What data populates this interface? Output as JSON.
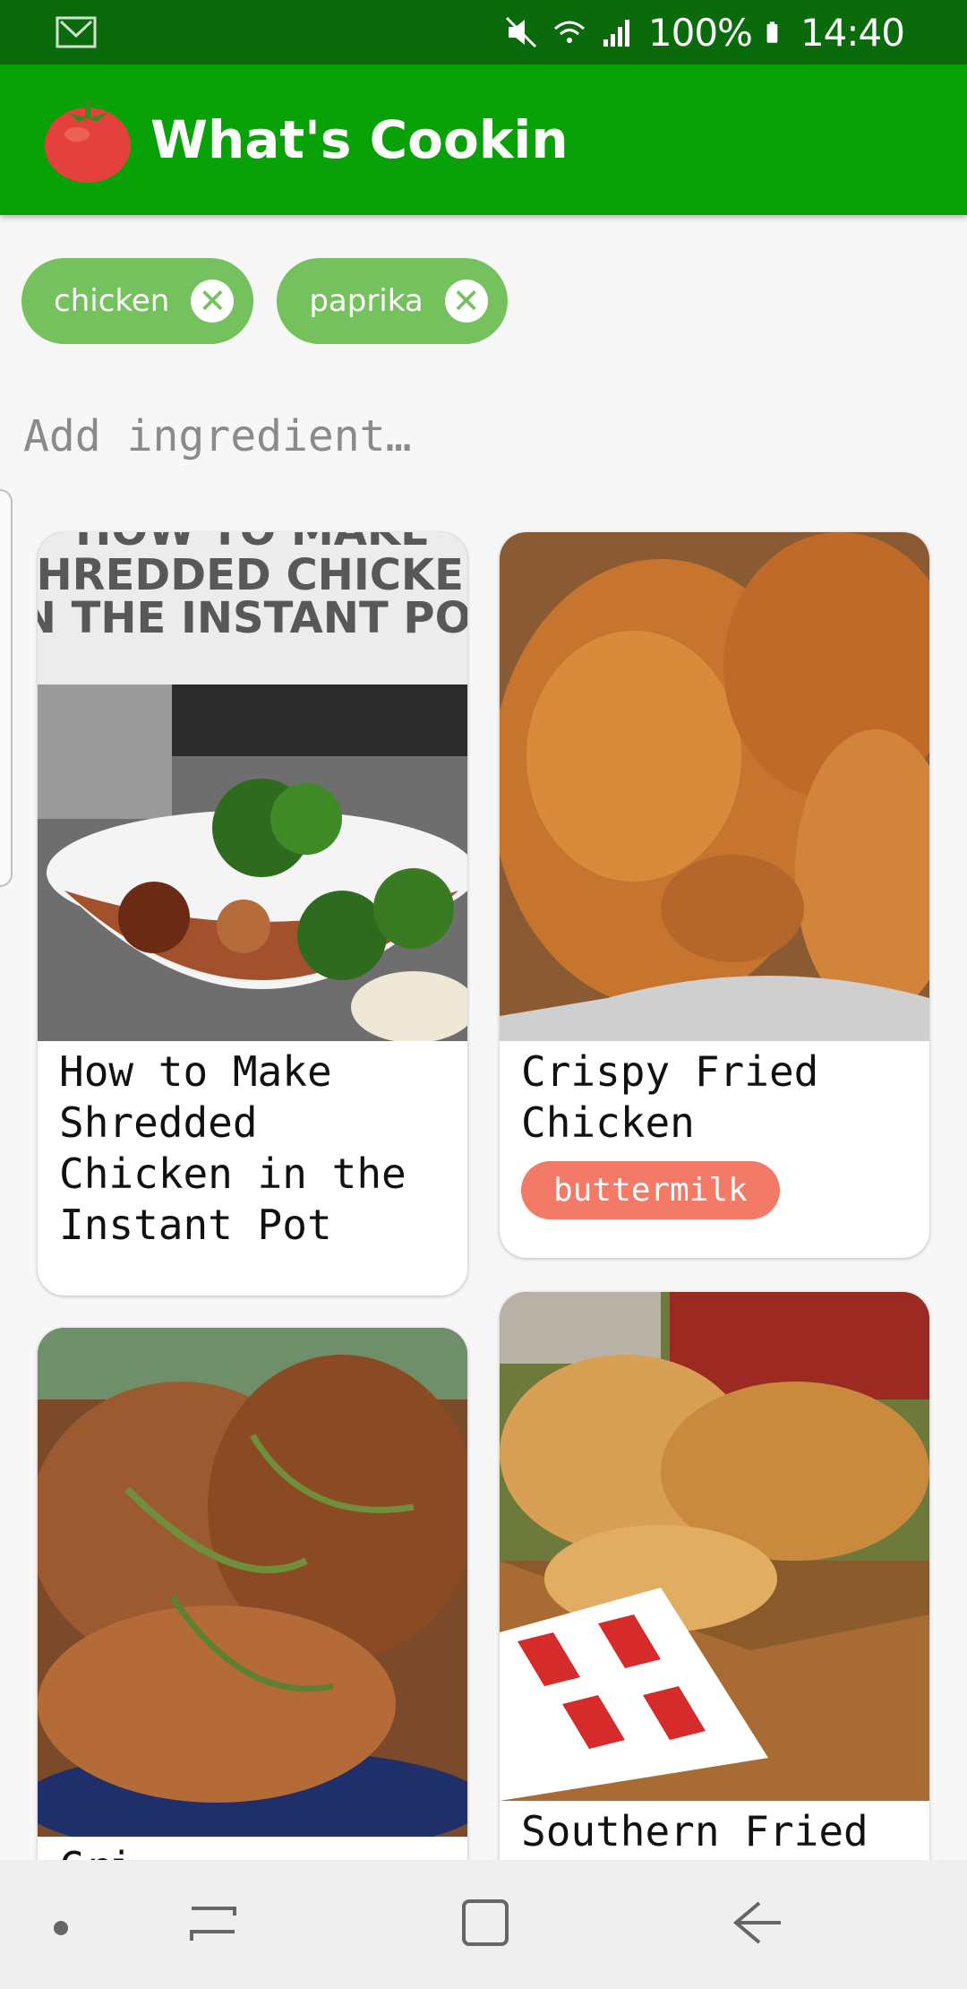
{
  "status_bar": {
    "battery_text": "100%",
    "time": "14:40",
    "icons": [
      "gmail-icon",
      "mute-icon",
      "wifi-icon",
      "signal-icon",
      "battery-icon"
    ]
  },
  "app_bar": {
    "title": "What's Cookin",
    "logo": "tomato-logo"
  },
  "chips": [
    {
      "label": "chicken"
    },
    {
      "label": "paprika"
    }
  ],
  "search": {
    "placeholder": "Add ingredient…"
  },
  "recipes": [
    {
      "title": "How to Make Shredded Chicken in the Instant Pot",
      "image_text": [
        "HOW TO MAKE",
        "SHREDDED CHICKEN",
        "IN THE INSTANT POT"
      ],
      "tags": []
    },
    {
      "title": "Crispy Fried Chicken",
      "tags": [
        "buttermilk"
      ]
    },
    {
      "title": "Cri…",
      "tags": []
    },
    {
      "title": "Southern Fried",
      "tags": []
    }
  ],
  "colors": {
    "status_bar": "#0b6a0b",
    "app_bar": "#08a108",
    "chip": "#74c15e",
    "tag": "#f47a68"
  }
}
